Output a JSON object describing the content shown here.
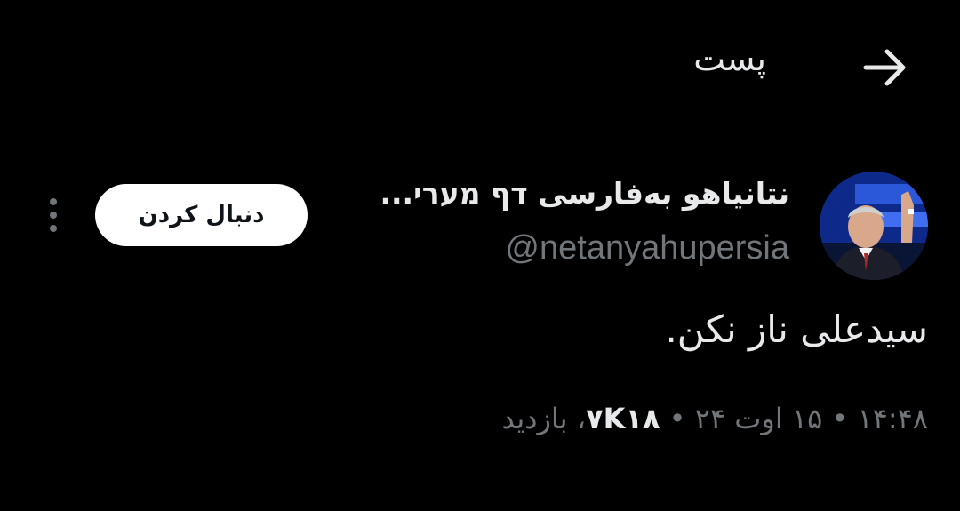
{
  "header": {
    "title": "پست",
    "back_icon": "arrow-right-icon"
  },
  "author": {
    "display_name": "نتانیاهو به‌فارسی דף מערי...",
    "handle": "@netanyahupersia",
    "avatar_icon": "user-avatar"
  },
  "follow_button": {
    "label": "دنبال کردن"
  },
  "more_icon": "more-vertical-icon",
  "tweet": {
    "text": "سیدعلی ناز نکن."
  },
  "meta": {
    "time": "۱۴:۴۸",
    "separator": "•",
    "date": "۱۵ اوت ۲۴",
    "views_count": "۷K۱۸",
    "views_label": "، بازدید"
  },
  "colors": {
    "background": "#000000",
    "primary_text": "#e7e9ea",
    "secondary_text": "#71767b",
    "divider": "#2f3336",
    "button_bg": "#ffffff"
  }
}
